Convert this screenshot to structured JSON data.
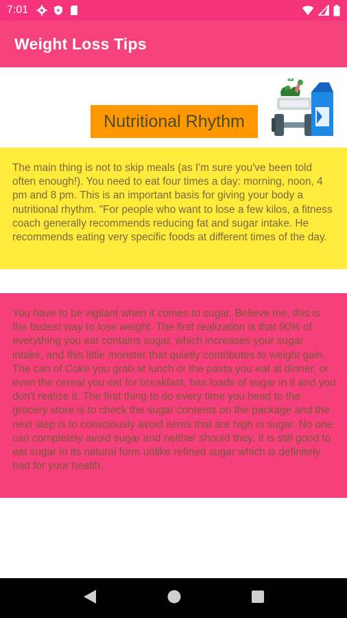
{
  "status_bar": {
    "time": "7:01",
    "left_icons": [
      "gear-icon",
      "play-protect-icon",
      "sd-card-icon"
    ],
    "right_icons": [
      "wifi-icon",
      "signal-icon",
      "battery-icon"
    ]
  },
  "app_bar": {
    "title": "Weight Loss Tips"
  },
  "section": {
    "title": "Nutritional Rhythm",
    "illustration": "food-fitness-illustration"
  },
  "blocks": [
    {
      "background": "#ffeb3b",
      "text": "The main thing is not to skip meals (as I'm sure you've been told often enough!). You need to eat four times a day: morning, noon, 4 pm and 8 pm. This is an important basis for giving your body a nutritional rhythm. \"For people who want to lose a few kilos, a fitness coach generally recommends reducing fat and sugar intake. He recommends eating very specific foods at different times of the day."
    },
    {
      "background": "#f5407c",
      "text": "You have to be vigilant when it comes to sugar. Believe me, this is the fastest way to lose weight. The first realization is that 90% of everything you eat contains sugar, which increases your sugar intake, and this little monster that quietly contributes to weight gain. The can of Coke you grab at lunch or the pasta you eat at dinner, or even the cereal you eat for breakfast, has loads of sugar in it and you don't realize it. The first thing to do every time you head to the grocery store is to check the sugar contents on the package and the next step is to consciously avoid items that are high in sugar. No one can completely avoid sugar and neither should they. It is still good to eat sugar in its natural form unlike refined sugar which is definitely bad for your health."
    }
  ],
  "nav_bar": {
    "buttons": [
      "back-icon",
      "home-icon",
      "recents-icon"
    ]
  },
  "colors": {
    "status_bar": "#f4337a",
    "app_bar": "#f5417c",
    "title_badge": "#ff9800",
    "yellow_block": "#ffeb3b",
    "pink_block": "#f5407c"
  }
}
